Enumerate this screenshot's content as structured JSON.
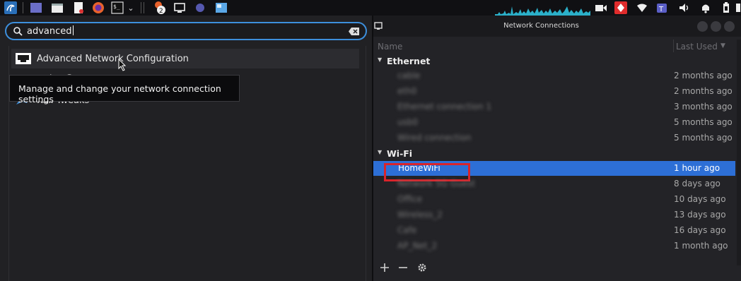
{
  "search": {
    "query": "advanced"
  },
  "results": [
    {
      "label": "Advanced Network Configuration"
    },
    {
      "label": "radare2"
    },
    {
      "label": "Kali Tweaks"
    }
  ],
  "tooltip": "Manage and change your network connection settings",
  "taskbar": {
    "badge": "2"
  },
  "nc": {
    "title": "Network Connections",
    "col_name": "Name",
    "col_last": "Last Used",
    "sections": [
      {
        "label": "Ethernet",
        "rows": [
          {
            "name": "cable",
            "time": "2 months ago"
          },
          {
            "name": "eth0",
            "time": "2 months ago"
          },
          {
            "name": "Ethernet connection 1",
            "time": "3 months ago"
          },
          {
            "name": "usb0",
            "time": "5 months ago"
          },
          {
            "name": "Wired connection",
            "time": "5 months ago"
          }
        ]
      },
      {
        "label": "Wi-Fi",
        "rows": [
          {
            "name": "HomeWiFi",
            "time": "1 hour ago",
            "selected": true
          },
          {
            "name": "Network 5G Guest",
            "time": "8 days ago"
          },
          {
            "name": "Office",
            "time": "10 days ago"
          },
          {
            "name": "Wireless_2",
            "time": "13 days ago"
          },
          {
            "name": "Cafe",
            "time": "16 days ago"
          },
          {
            "name": "AP_Net_2",
            "time": "1 month ago"
          }
        ]
      }
    ]
  },
  "colors": {
    "accent": "#3d8fdc",
    "selection": "#2d6fd6",
    "highlight": "#d9242b"
  }
}
